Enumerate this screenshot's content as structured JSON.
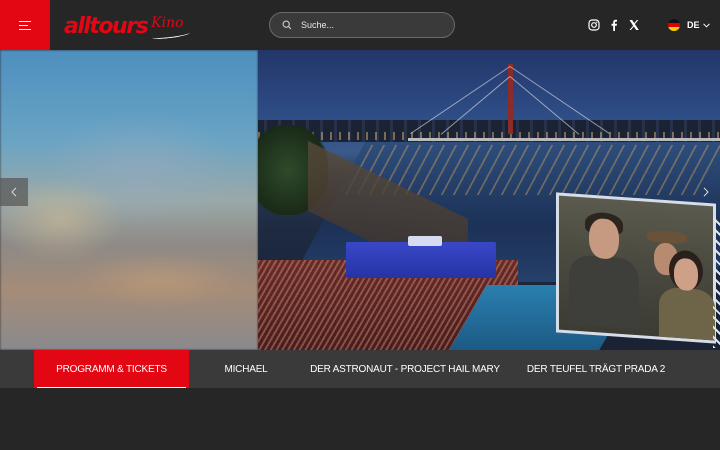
{
  "header": {
    "logo_text": "alltours",
    "logo_sub": "Kino",
    "search": {
      "placeholder": "Suche..."
    },
    "language": {
      "code": "DE",
      "flag": "germany-flag"
    },
    "social": [
      "instagram-icon",
      "facebook-icon",
      "x-icon"
    ]
  },
  "hero": {
    "carousel_prev_icon": "chevron-left-icon",
    "carousel_next_icon": "chevron-right-icon"
  },
  "tabs": [
    {
      "label": "PROGRAMM & TICKETS",
      "active": true
    },
    {
      "label": "MICHAEL",
      "active": false
    },
    {
      "label": "DER ASTRONAUT - PROJECT HAIL MARY",
      "active": false
    },
    {
      "label": "DER TEUFEL TRÄGT PRADA 2",
      "active": false
    }
  ],
  "colors": {
    "brand_red": "#e30613",
    "header_bg": "#262626",
    "tab_bar_bg": "#3a3a3a"
  }
}
